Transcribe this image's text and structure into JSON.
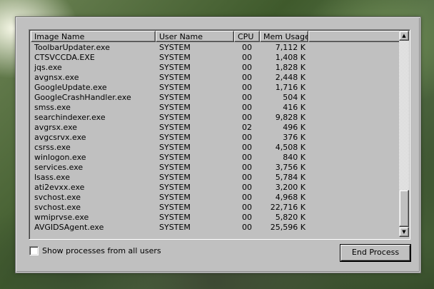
{
  "columns": {
    "image_name": "Image Name",
    "user_name": "User Name",
    "cpu": "CPU",
    "mem_usage": "Mem Usage"
  },
  "processes": [
    {
      "name": "ToolbarUpdater.exe",
      "user": "SYSTEM",
      "cpu": "00",
      "mem": "7,112 K"
    },
    {
      "name": "CTSVCCDA.EXE",
      "user": "SYSTEM",
      "cpu": "00",
      "mem": "1,408 K"
    },
    {
      "name": "jqs.exe",
      "user": "SYSTEM",
      "cpu": "00",
      "mem": "1,828 K"
    },
    {
      "name": "avgnsx.exe",
      "user": "SYSTEM",
      "cpu": "00",
      "mem": "2,448 K"
    },
    {
      "name": "GoogleUpdate.exe",
      "user": "SYSTEM",
      "cpu": "00",
      "mem": "1,716 K"
    },
    {
      "name": "GoogleCrashHandler.exe",
      "user": "SYSTEM",
      "cpu": "00",
      "mem": "504 K"
    },
    {
      "name": "smss.exe",
      "user": "SYSTEM",
      "cpu": "00",
      "mem": "416 K"
    },
    {
      "name": "searchindexer.exe",
      "user": "SYSTEM",
      "cpu": "00",
      "mem": "9,828 K"
    },
    {
      "name": "avgrsx.exe",
      "user": "SYSTEM",
      "cpu": "02",
      "mem": "496 K"
    },
    {
      "name": "avgcsrvx.exe",
      "user": "SYSTEM",
      "cpu": "00",
      "mem": "376 K"
    },
    {
      "name": "csrss.exe",
      "user": "SYSTEM",
      "cpu": "00",
      "mem": "4,508 K"
    },
    {
      "name": "winlogon.exe",
      "user": "SYSTEM",
      "cpu": "00",
      "mem": "840 K"
    },
    {
      "name": "services.exe",
      "user": "SYSTEM",
      "cpu": "00",
      "mem": "3,756 K"
    },
    {
      "name": "lsass.exe",
      "user": "SYSTEM",
      "cpu": "00",
      "mem": "5,784 K"
    },
    {
      "name": "ati2evxx.exe",
      "user": "SYSTEM",
      "cpu": "00",
      "mem": "3,200 K"
    },
    {
      "name": "svchost.exe",
      "user": "SYSTEM",
      "cpu": "00",
      "mem": "4,968 K"
    },
    {
      "name": "svchost.exe",
      "user": "SYSTEM",
      "cpu": "00",
      "mem": "22,716 K"
    },
    {
      "name": "wmiprvse.exe",
      "user": "SYSTEM",
      "cpu": "00",
      "mem": "5,820 K"
    },
    {
      "name": "AVGIDSAgent.exe",
      "user": "SYSTEM",
      "cpu": "00",
      "mem": "25,596 K"
    }
  ],
  "scrollbar": {
    "up_icon": "arrow-up-icon",
    "down_icon": "arrow-down-icon",
    "position": "bottom"
  },
  "show_all_checkbox": {
    "label": "Show processes from all users",
    "checked": false
  },
  "end_process_button": "End Process",
  "colors": {
    "dialog_face": "#c0c0c0",
    "highlight": "#ffffff",
    "shadow": "#808080"
  }
}
